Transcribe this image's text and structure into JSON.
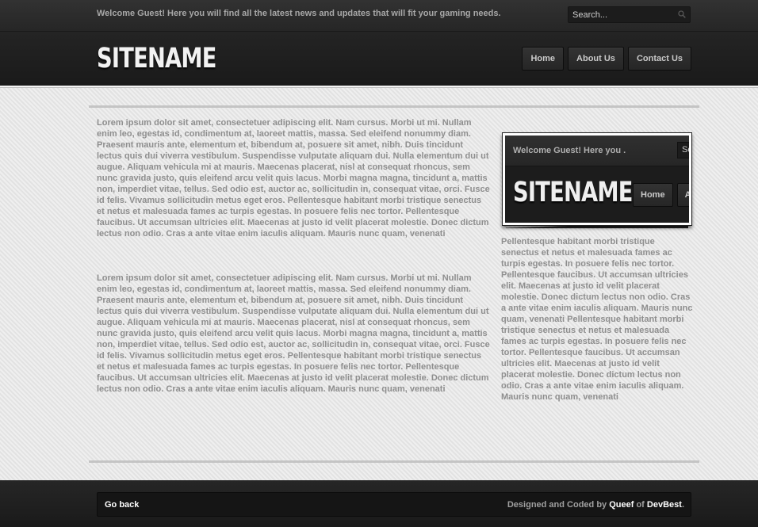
{
  "topbar": {
    "welcome": "Welcome Guest! Here you will find all the latest news and updates that will fit your gaming needs.",
    "search_placeholder": "Search..."
  },
  "header": {
    "logo": "SITENAME",
    "nav": [
      "Home",
      "About Us",
      "Contact Us"
    ]
  },
  "main": {
    "paragraph1": "Lorem ipsum dolor sit amet, consectetuer adipiscing elit. Nam cursus. Morbi ut mi. Nullam enim leo, egestas id, condimentum at, laoreet mattis, massa. Sed eleifend nonummy diam. Praesent mauris ante, elementum et, bibendum at, posuere sit amet, nibh. Duis tincidunt lectus quis dui viverra vestibulum. Suspendisse vulputate aliquam dui. Nulla elementum dui ut augue. Aliquam vehicula mi at mauris. Maecenas placerat, nisl at consequat rhoncus, sem nunc gravida justo, quis eleifend arcu velit quis lacus. Morbi magna magna, tincidunt a, mattis non, imperdiet vitae, tellus. Sed odio est, auctor ac, sollicitudin in, consequat vitae, orci. Fusce id felis. Vivamus sollicitudin metus eget eros. Pellentesque habitant morbi tristique senectus et netus et malesuada fames ac turpis egestas. In posuere felis nec tortor. Pellentesque faucibus. Ut accumsan ultricies elit. Maecenas at justo id velit placerat molestie. Donec dictum lectus non odio. Cras a ante vitae enim iaculis aliquam. Mauris nunc quam, venenati",
    "paragraph2": "Lorem ipsum dolor sit amet, consectetuer adipiscing elit. Nam cursus. Morbi ut mi. Nullam enim leo, egestas id, condimentum at, laoreet mattis, massa. Sed eleifend nonummy diam. Praesent mauris ante, elementum et, bibendum at, posuere sit amet, nibh. Duis tincidunt lectus quis dui viverra vestibulum. Suspendisse vulputate aliquam dui. Nulla elementum dui ut augue. Aliquam vehicula mi at mauris. Maecenas placerat, nisl at consequat rhoncus, sem nunc gravida justo, quis eleifend arcu velit quis lacus. Morbi magna magna, tincidunt a, mattis non, imperdiet vitae, tellus. Sed odio est, auctor ac, sollicitudin in, consequat vitae, orci. Fusce id felis. Vivamus sollicitudin metus eget eros. Pellentesque habitant morbi tristique senectus et netus et malesuada fames ac turpis egestas. In posuere felis nec tortor. Pellentesque faucibus. Ut accumsan ultricies elit. Maecenas at justo id velit placerat molestie. Donec dictum lectus non odio. Cras a ante vitae enim iaculis aliquam. Mauris nunc quam, venenati"
  },
  "sidebar": {
    "preview": {
      "welcome": "Welcome Guest! Here you .",
      "search": "Se",
      "logo": "SITENAME",
      "nav_home": "Home",
      "nav_about": "A"
    },
    "text": "Pellentesque habitant morbi tristique senectus et netus et malesuada fames ac turpis egestas. In posuere felis nec tortor. Pellentesque faucibus. Ut accumsan ultricies elit. Maecenas at justo id velit placerat molestie. Donec dictum lectus non odio. Cras a ante vitae enim iaculis aliquam. Mauris nunc quam, venenati Pellentesque habitant morbi tristique senectus et netus et malesuada fames ac turpis egestas. In posuere felis nec tortor. Pellentesque faucibus. Ut accumsan ultricies elit. Maecenas at justo id velit placerat molestie. Donec dictum lectus non odio. Cras a ante vitae enim iaculis aliquam. Mauris nunc quam, venenati"
  },
  "footer": {
    "go_back": "Go back",
    "credit_prefix": "Designed and Coded by ",
    "credit_author": "Queef",
    "credit_mid": " of ",
    "credit_site": "DevBest",
    "credit_end": "."
  },
  "colors": {
    "dark_bar": "#262626",
    "page_bg": "#e6e6e6",
    "body_text": "#8e8e8e",
    "rule": "#c4c4c4"
  },
  "icons": {
    "search": "magnifier-icon"
  }
}
